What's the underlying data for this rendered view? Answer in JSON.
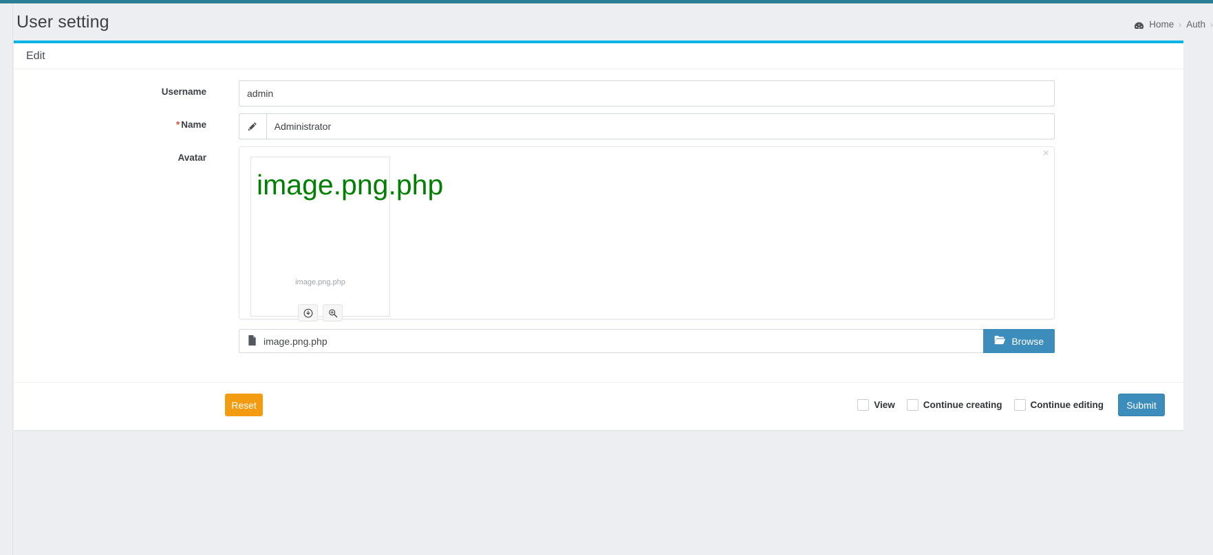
{
  "header": {
    "title": "User setting",
    "breadcrumb": {
      "home_icon": "dashboard-icon",
      "items": [
        "Home",
        "Auth"
      ],
      "separator": "›"
    }
  },
  "card": {
    "title": "Edit",
    "accent_color": "#00b5e5"
  },
  "form": {
    "username": {
      "label": "Username",
      "value": "admin",
      "placeholder": ""
    },
    "name": {
      "label": "Name",
      "required_mark": "*",
      "value": "Administrator",
      "placeholder": "",
      "addon_icon": "pencil-icon"
    },
    "avatar": {
      "label": "Avatar",
      "close_icon": "×",
      "preview_text": "image.png.php",
      "caption": "image.png.php",
      "actions": [
        {
          "icon": "download-circle-icon",
          "name": "download"
        },
        {
          "icon": "zoom-in-icon",
          "name": "preview"
        }
      ],
      "file_icon": "file-icon",
      "file_name": "image.png.php",
      "browse_label": "Browse",
      "browse_icon": "folder-open-icon",
      "preview_text_color": "#008000"
    }
  },
  "footer": {
    "reset_label": "Reset",
    "submit_label": "Submit",
    "checkboxes": [
      {
        "label": "View",
        "checked": false
      },
      {
        "label": "Continue creating",
        "checked": false
      },
      {
        "label": "Continue editing",
        "checked": false
      }
    ],
    "reset_color": "#f39c12",
    "submit_color": "#3c8dbc"
  }
}
